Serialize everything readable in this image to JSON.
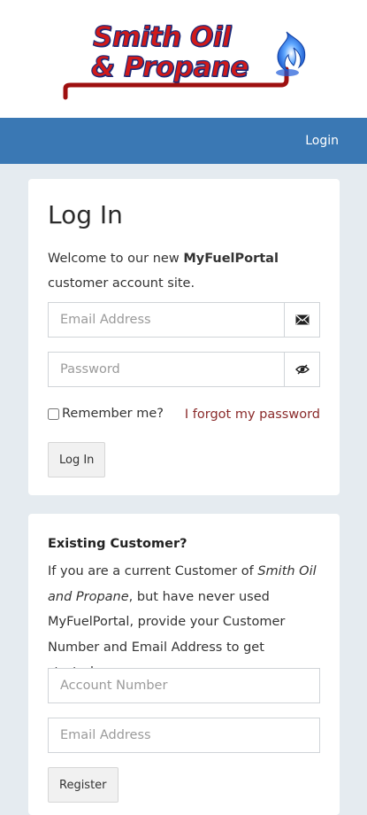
{
  "brand": {
    "line1": "Smith Oil",
    "line2": "& Propane"
  },
  "nav": {
    "login": "Login"
  },
  "login_card": {
    "title": "Log In",
    "welcome_prefix": "Welcome to our new ",
    "welcome_brand": "MyFuelPortal",
    "welcome_suffix": " customer account site.",
    "email_placeholder": "Email Address",
    "password_placeholder": "Password",
    "remember_label": "Remember me?",
    "forgot_link": "I forgot my password",
    "submit_label": "Log In"
  },
  "register_card": {
    "title": "Existing Customer?",
    "text_prefix": "If you are a current Customer of ",
    "company": "Smith Oil and Propane",
    "text_suffix": ", but have never used MyFuelPortal, provide your Customer Number and Email Address to get started.",
    "account_placeholder": "Account Number",
    "email_placeholder": "Email Address",
    "submit_label": "Register"
  },
  "colors": {
    "navbar": "#3a78b4",
    "brand_red": "#d11a1a",
    "brand_navy": "#1a2a7a",
    "link": "#8a2a2a",
    "page_bg": "#e5ebf0"
  },
  "icons": {
    "email": "envelope-icon",
    "password": "eye-slash-icon",
    "logo_flame": "flame-icon"
  }
}
